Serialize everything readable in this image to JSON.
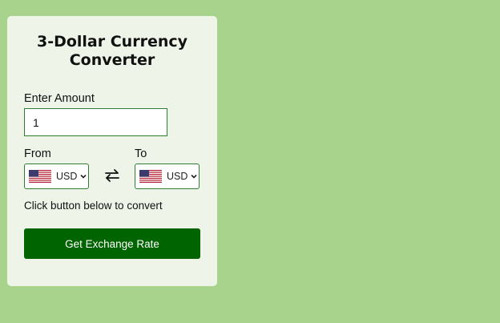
{
  "converter": {
    "title": "3-Dollar Currency\nConverter",
    "amount_label": "Enter Amount",
    "amount_value": "1",
    "from_label": "From",
    "to_label": "To",
    "from_currency": "USD",
    "to_currency": "USD",
    "from_flag": "us-flag-icon",
    "to_flag": "us-flag-icon",
    "swap_icon": "swap-arrows-icon",
    "hint_text": "Click button below to convert",
    "button_label": "Get Exchange Rate"
  },
  "colors": {
    "page_background": "#a8d38c",
    "card_background": "#eef5e8",
    "accent_green": "#006400",
    "border_green": "#2e7d32"
  }
}
